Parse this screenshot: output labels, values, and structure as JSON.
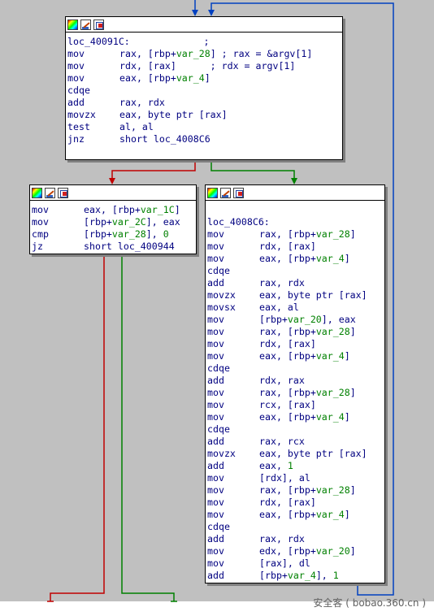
{
  "colors": {
    "canvas_bg": "#c0c0c0",
    "edge_true": "#008000",
    "edge_false": "#c00000",
    "edge_loop": "#0040c0",
    "mnemonic": "#000080",
    "variable": "#008000"
  },
  "toolbar_icons": [
    "palette-icon",
    "edit-icon",
    "graph-icon"
  ],
  "nodes": {
    "top": {
      "lines": [
        {
          "kind": "label",
          "text": "loc_40091C:             ;"
        },
        {
          "kind": "ins",
          "mnemonic": "mov",
          "parts": [
            [
              "t",
              "rax, [rbp+"
            ],
            [
              "v",
              "var_28"
            ],
            [
              "t",
              "] ; rax = &argv[1]"
            ]
          ]
        },
        {
          "kind": "ins",
          "mnemonic": "mov",
          "parts": [
            [
              "t",
              "rdx, [rax]      ; rdx = argv[1]"
            ]
          ]
        },
        {
          "kind": "ins",
          "mnemonic": "mov",
          "parts": [
            [
              "t",
              "eax, [rbp+"
            ],
            [
              "v",
              "var_4"
            ],
            [
              "t",
              "]"
            ]
          ]
        },
        {
          "kind": "ins",
          "mnemonic": "cdqe",
          "parts": []
        },
        {
          "kind": "ins",
          "mnemonic": "add",
          "parts": [
            [
              "t",
              "rax, rdx"
            ]
          ]
        },
        {
          "kind": "ins",
          "mnemonic": "movzx",
          "parts": [
            [
              "t",
              "eax, byte ptr [rax]"
            ]
          ]
        },
        {
          "kind": "ins",
          "mnemonic": "test",
          "parts": [
            [
              "t",
              "al, al"
            ]
          ]
        },
        {
          "kind": "ins",
          "mnemonic": "jnz",
          "parts": [
            [
              "t",
              "short loc_4008C6"
            ]
          ]
        }
      ]
    },
    "left": {
      "lines": [
        {
          "kind": "ins",
          "mnemonic": "mov",
          "parts": [
            [
              "t",
              "eax, [rbp+"
            ],
            [
              "v",
              "var_1C"
            ],
            [
              "t",
              "]"
            ]
          ]
        },
        {
          "kind": "ins",
          "mnemonic": "mov",
          "parts": [
            [
              "t",
              "[rbp+"
            ],
            [
              "v",
              "var_2C"
            ],
            [
              "t",
              "], eax"
            ]
          ]
        },
        {
          "kind": "ins",
          "mnemonic": "cmp",
          "parts": [
            [
              "t",
              "[rbp+"
            ],
            [
              "v",
              "var_28"
            ],
            [
              "t",
              "], "
            ],
            [
              "n",
              "0"
            ]
          ]
        },
        {
          "kind": "ins",
          "mnemonic": "jz",
          "parts": [
            [
              "t",
              "short loc_400944"
            ]
          ]
        }
      ]
    },
    "right": {
      "lines": [
        {
          "kind": "blank",
          "text": ""
        },
        {
          "kind": "label",
          "text": "loc_4008C6:"
        },
        {
          "kind": "ins",
          "mnemonic": "mov",
          "parts": [
            [
              "t",
              "rax, [rbp+"
            ],
            [
              "v",
              "var_28"
            ],
            [
              "t",
              "]"
            ]
          ]
        },
        {
          "kind": "ins",
          "mnemonic": "mov",
          "parts": [
            [
              "t",
              "rdx, [rax]"
            ]
          ]
        },
        {
          "kind": "ins",
          "mnemonic": "mov",
          "parts": [
            [
              "t",
              "eax, [rbp+"
            ],
            [
              "v",
              "var_4"
            ],
            [
              "t",
              "]"
            ]
          ]
        },
        {
          "kind": "ins",
          "mnemonic": "cdqe",
          "parts": []
        },
        {
          "kind": "ins",
          "mnemonic": "add",
          "parts": [
            [
              "t",
              "rax, rdx"
            ]
          ]
        },
        {
          "kind": "ins",
          "mnemonic": "movzx",
          "parts": [
            [
              "t",
              "eax, byte ptr [rax]"
            ]
          ]
        },
        {
          "kind": "ins",
          "mnemonic": "movsx",
          "parts": [
            [
              "t",
              "eax, al"
            ]
          ]
        },
        {
          "kind": "ins",
          "mnemonic": "mov",
          "parts": [
            [
              "t",
              "[rbp+"
            ],
            [
              "v",
              "var_20"
            ],
            [
              "t",
              "], eax"
            ]
          ]
        },
        {
          "kind": "ins",
          "mnemonic": "mov",
          "parts": [
            [
              "t",
              "rax, [rbp+"
            ],
            [
              "v",
              "var_28"
            ],
            [
              "t",
              "]"
            ]
          ]
        },
        {
          "kind": "ins",
          "mnemonic": "mov",
          "parts": [
            [
              "t",
              "rdx, [rax]"
            ]
          ]
        },
        {
          "kind": "ins",
          "mnemonic": "mov",
          "parts": [
            [
              "t",
              "eax, [rbp+"
            ],
            [
              "v",
              "var_4"
            ],
            [
              "t",
              "]"
            ]
          ]
        },
        {
          "kind": "ins",
          "mnemonic": "cdqe",
          "parts": []
        },
        {
          "kind": "ins",
          "mnemonic": "add",
          "parts": [
            [
              "t",
              "rdx, rax"
            ]
          ]
        },
        {
          "kind": "ins",
          "mnemonic": "mov",
          "parts": [
            [
              "t",
              "rax, [rbp+"
            ],
            [
              "v",
              "var_28"
            ],
            [
              "t",
              "]"
            ]
          ]
        },
        {
          "kind": "ins",
          "mnemonic": "mov",
          "parts": [
            [
              "t",
              "rcx, [rax]"
            ]
          ]
        },
        {
          "kind": "ins",
          "mnemonic": "mov",
          "parts": [
            [
              "t",
              "eax, [rbp+"
            ],
            [
              "v",
              "var_4"
            ],
            [
              "t",
              "]"
            ]
          ]
        },
        {
          "kind": "ins",
          "mnemonic": "cdqe",
          "parts": []
        },
        {
          "kind": "ins",
          "mnemonic": "add",
          "parts": [
            [
              "t",
              "rax, rcx"
            ]
          ]
        },
        {
          "kind": "ins",
          "mnemonic": "movzx",
          "parts": [
            [
              "t",
              "eax, byte ptr [rax]"
            ]
          ]
        },
        {
          "kind": "ins",
          "mnemonic": "add",
          "parts": [
            [
              "t",
              "eax, "
            ],
            [
              "n",
              "1"
            ]
          ]
        },
        {
          "kind": "ins",
          "mnemonic": "mov",
          "parts": [
            [
              "t",
              "[rdx], al"
            ]
          ]
        },
        {
          "kind": "ins",
          "mnemonic": "mov",
          "parts": [
            [
              "t",
              "rax, [rbp+"
            ],
            [
              "v",
              "var_28"
            ],
            [
              "t",
              "]"
            ]
          ]
        },
        {
          "kind": "ins",
          "mnemonic": "mov",
          "parts": [
            [
              "t",
              "rdx, [rax]"
            ]
          ]
        },
        {
          "kind": "ins",
          "mnemonic": "mov",
          "parts": [
            [
              "t",
              "eax, [rbp+"
            ],
            [
              "v",
              "var_4"
            ],
            [
              "t",
              "]"
            ]
          ]
        },
        {
          "kind": "ins",
          "mnemonic": "cdqe",
          "parts": []
        },
        {
          "kind": "ins",
          "mnemonic": "add",
          "parts": [
            [
              "t",
              "rax, rdx"
            ]
          ]
        },
        {
          "kind": "ins",
          "mnemonic": "mov",
          "parts": [
            [
              "t",
              "edx, [rbp+"
            ],
            [
              "v",
              "var_20"
            ],
            [
              "t",
              "]"
            ]
          ]
        },
        {
          "kind": "ins",
          "mnemonic": "mov",
          "parts": [
            [
              "t",
              "[rax], dl"
            ]
          ]
        },
        {
          "kind": "ins",
          "mnemonic": "add",
          "parts": [
            [
              "t",
              "[rbp+"
            ],
            [
              "v",
              "var_4"
            ],
            [
              "t",
              "], "
            ],
            [
              "n",
              "1"
            ]
          ]
        }
      ]
    }
  },
  "watermark": "安全客 ( bobao.360.cn )"
}
